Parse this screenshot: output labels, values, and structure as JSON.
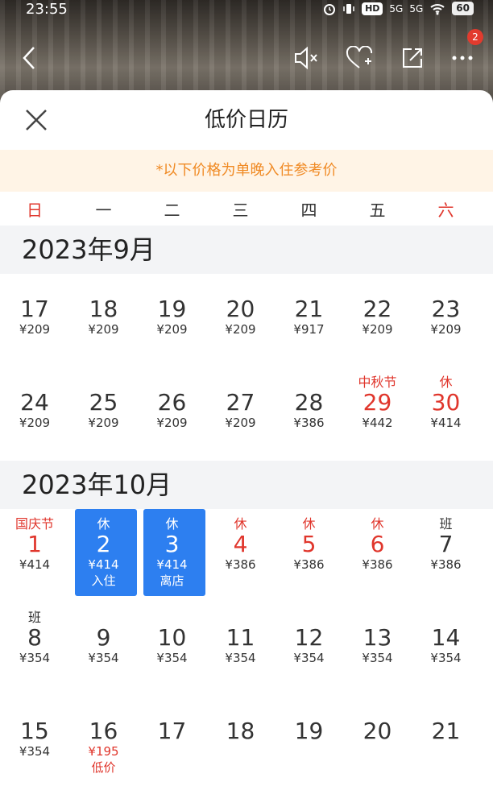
{
  "status_bar": {
    "time": "23:55",
    "hd": "HD",
    "net1": "5G",
    "net2": "5G",
    "battery": "60"
  },
  "top_nav": {
    "badge_count": "2"
  },
  "sheet": {
    "title": "低价日历",
    "notice": "*以下价格为单晚入住参考价",
    "weekdays": [
      "日",
      "一",
      "二",
      "三",
      "四",
      "五",
      "六"
    ]
  },
  "months": [
    {
      "label": "2023年9月",
      "weeks": [
        [
          {
            "day": "17",
            "price": "¥209"
          },
          {
            "day": "18",
            "price": "¥209"
          },
          {
            "day": "19",
            "price": "¥209"
          },
          {
            "day": "20",
            "price": "¥209"
          },
          {
            "day": "21",
            "price": "¥917"
          },
          {
            "day": "22",
            "price": "¥209"
          },
          {
            "day": "23",
            "price": "¥209"
          }
        ],
        [
          {
            "day": "24",
            "price": "¥209"
          },
          {
            "day": "25",
            "price": "¥209"
          },
          {
            "day": "26",
            "price": "¥209"
          },
          {
            "day": "27",
            "price": "¥209"
          },
          {
            "day": "28",
            "price": "¥386"
          },
          {
            "day": "29",
            "price": "¥442",
            "tag": "中秋节",
            "red": true
          },
          {
            "day": "30",
            "price": "¥414",
            "tag": "休",
            "red": true
          }
        ]
      ]
    },
    {
      "label": "2023年10月",
      "weeks": [
        [
          {
            "day": "1",
            "price": "¥414",
            "tag": "国庆节",
            "red": true
          },
          {
            "day": "2",
            "price": "¥414",
            "tag": "休",
            "sub": "入住",
            "selected": true
          },
          {
            "day": "3",
            "price": "¥414",
            "tag": "休",
            "sub": "离店",
            "selected": true
          },
          {
            "day": "4",
            "price": "¥386",
            "tag": "休",
            "red": true
          },
          {
            "day": "5",
            "price": "¥386",
            "tag": "休",
            "red": true
          },
          {
            "day": "6",
            "price": "¥386",
            "tag": "休",
            "red": true
          },
          {
            "day": "7",
            "price": "¥386",
            "tag": "班"
          }
        ],
        [
          {
            "day": "8",
            "price": "¥354",
            "tag": "班"
          },
          {
            "day": "9",
            "price": "¥354"
          },
          {
            "day": "10",
            "price": "¥354"
          },
          {
            "day": "11",
            "price": "¥354"
          },
          {
            "day": "12",
            "price": "¥354"
          },
          {
            "day": "13",
            "price": "¥354"
          },
          {
            "day": "14",
            "price": "¥354"
          }
        ],
        [
          {
            "day": "15",
            "price": "¥354"
          },
          {
            "day": "16",
            "price": "¥195",
            "sub": "低价",
            "price_red": true
          },
          {
            "day": "17"
          },
          {
            "day": "18"
          },
          {
            "day": "19"
          },
          {
            "day": "20"
          },
          {
            "day": "21"
          }
        ]
      ]
    }
  ]
}
